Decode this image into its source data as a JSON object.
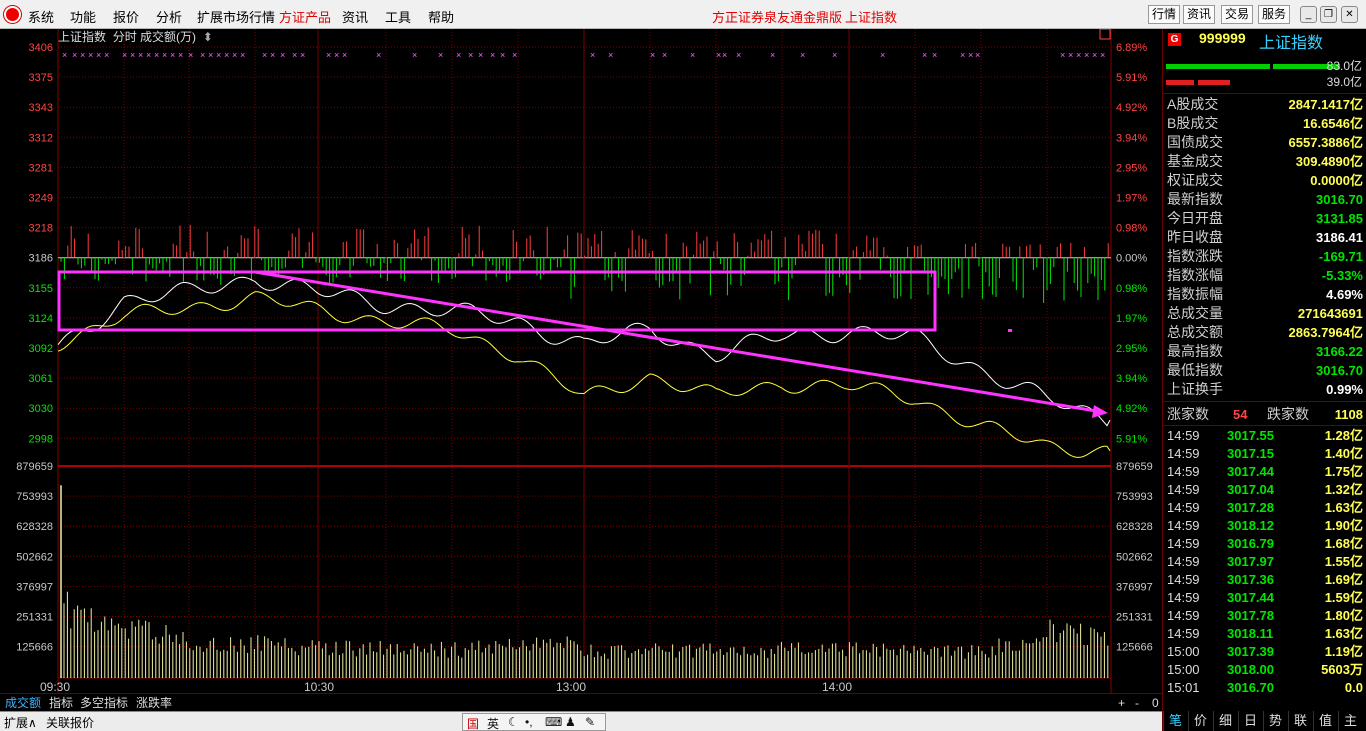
{
  "menubar": {
    "items": [
      "系统",
      "功能",
      "报价",
      "分析",
      "扩展市场行情",
      "方证产品",
      "资讯",
      "工具",
      "帮助"
    ],
    "center_label": "方正证券泉友通金鼎版",
    "center_index": "上证指数",
    "right_buttons": [
      "行情",
      "资讯",
      "交易",
      "服务"
    ]
  },
  "chart": {
    "index_name": "上证指数",
    "period": "分时",
    "indicator": "成交额(万)",
    "close_button": "×",
    "price_labels": [
      "3406",
      "3375",
      "3343",
      "3312",
      "3281",
      "3249",
      "3218",
      "3186",
      "3155",
      "3124",
      "3092",
      "3061",
      "3030",
      "2998"
    ],
    "percent_labels": [
      "6.89%",
      "5.91%",
      "4.92%",
      "3.94%",
      "2.95%",
      "1.97%",
      "0.98%",
      "0.00%",
      "0.98%",
      "1.97%",
      "2.95%",
      "3.94%",
      "4.92%",
      "5.91%"
    ],
    "volume_labels": [
      "879659",
      "753993",
      "628328",
      "502662",
      "376997",
      "251331",
      "125666"
    ],
    "time_labels": [
      "09:30",
      "10:30",
      "13:00",
      "14:00"
    ],
    "scroll_buttons": [
      "+",
      "-",
      "0"
    ]
  },
  "colors": {
    "up": "#ff3c3c",
    "down": "#00e600",
    "grid": "#7a0000",
    "price_line": "#ffffff",
    "avg_line": "#ffff3c",
    "annotation": "#ff33ff",
    "volume": "#f0f0a0"
  },
  "chart_data": {
    "type": "line",
    "title": "上证指数 分时",
    "x_axis": {
      "ticks": [
        "09:30",
        "10:30",
        "13:00",
        "14:00"
      ]
    },
    "y_range": [
      2998,
      3406
    ],
    "prev_close": 3186.41,
    "series": [
      {
        "name": "price",
        "x": [
          "09:30",
          "09:45",
          "10:00",
          "10:15",
          "10:30",
          "10:45",
          "11:00",
          "11:15",
          "11:30",
          "13:15",
          "13:30",
          "13:45",
          "14:00",
          "14:15",
          "14:30",
          "14:45",
          "15:00"
        ],
        "values": [
          3092,
          3142,
          3150,
          3166,
          3150,
          3138,
          3130,
          3120,
          3095,
          3112,
          3085,
          3105,
          3110,
          3102,
          3070,
          3038,
          3017
        ]
      },
      {
        "name": "average",
        "x": [
          "09:30",
          "09:45",
          "10:00",
          "10:15",
          "10:30",
          "10:45",
          "11:00",
          "11:15",
          "11:30",
          "13:15",
          "13:30",
          "13:45",
          "14:00",
          "14:15",
          "14:30",
          "14:45",
          "15:00"
        ],
        "values": [
          3098,
          3125,
          3135,
          3144,
          3132,
          3120,
          3110,
          3085,
          3040,
          3063,
          3042,
          3055,
          3052,
          3040,
          3010,
          2990,
          2985
        ]
      },
      {
        "name": "volume",
        "x": [
          "09:30",
          "09:35",
          "10:00",
          "10:30",
          "11:00",
          "11:30",
          "13:00",
          "13:30",
          "14:00",
          "14:30",
          "14:45",
          "15:00"
        ],
        "values": [
          800000,
          310000,
          200000,
          160000,
          150000,
          190000,
          140000,
          150000,
          150000,
          140000,
          250000,
          230000
        ]
      }
    ],
    "volume_range": [
      0,
      879659
    ]
  },
  "quote": {
    "code": "999999",
    "name": "上证指数",
    "badge": "G",
    "buy_bar_value": "83.0亿",
    "sell_bar_value": "39.0亿",
    "rows": [
      {
        "label": "A股成交",
        "value": "2847.1417亿",
        "color": "yel"
      },
      {
        "label": "B股成交",
        "value": "16.6546亿",
        "color": "yel"
      },
      {
        "label": "国债成交",
        "value": "6557.3886亿",
        "color": "yel"
      },
      {
        "label": "基金成交",
        "value": "309.4890亿",
        "color": "yel"
      },
      {
        "label": "权证成交",
        "value": "0.0000亿",
        "color": "yel"
      },
      {
        "label": "最新指数",
        "value": "3016.70",
        "color": "green"
      },
      {
        "label": "今日开盘",
        "value": "3131.85",
        "color": "green"
      },
      {
        "label": "昨日收盘",
        "value": "3186.41",
        "color": "white"
      },
      {
        "label": "指数涨跌",
        "value": "-169.71",
        "color": "green"
      },
      {
        "label": "指数涨幅",
        "value": "-5.33%",
        "color": "green"
      },
      {
        "label": "指数振幅",
        "value": "4.69%",
        "color": "white"
      },
      {
        "label": "总成交量",
        "value": "271643691",
        "color": "yel"
      },
      {
        "label": "总成交额",
        "value": "2863.7964亿",
        "color": "yel"
      },
      {
        "label": "最高指数",
        "value": "3166.22",
        "color": "green"
      },
      {
        "label": "最低指数",
        "value": "3016.70",
        "color": "green"
      },
      {
        "label": "上证换手",
        "value": "0.99%",
        "color": "white"
      }
    ],
    "up_label": "涨家数",
    "up_count": "54",
    "down_label": "跌家数",
    "down_count": "1108"
  },
  "ticks": [
    {
      "time": "14:59",
      "price": "3017.55",
      "amount": "1.28亿"
    },
    {
      "time": "14:59",
      "price": "3017.15",
      "amount": "1.40亿"
    },
    {
      "time": "14:59",
      "price": "3017.44",
      "amount": "1.75亿"
    },
    {
      "time": "14:59",
      "price": "3017.04",
      "amount": "1.32亿"
    },
    {
      "time": "14:59",
      "price": "3017.28",
      "amount": "1.63亿"
    },
    {
      "time": "14:59",
      "price": "3018.12",
      "amount": "1.90亿"
    },
    {
      "time": "14:59",
      "price": "3016.79",
      "amount": "1.68亿"
    },
    {
      "time": "14:59",
      "price": "3017.97",
      "amount": "1.55亿"
    },
    {
      "time": "14:59",
      "price": "3017.36",
      "amount": "1.69亿"
    },
    {
      "time": "14:59",
      "price": "3017.44",
      "amount": "1.59亿"
    },
    {
      "time": "14:59",
      "price": "3017.78",
      "amount": "1.80亿"
    },
    {
      "time": "14:59",
      "price": "3018.11",
      "amount": "1.63亿"
    },
    {
      "time": "15:00",
      "price": "3017.39",
      "amount": "1.19亿"
    },
    {
      "time": "15:00",
      "price": "3018.00",
      "amount": "5603万"
    },
    {
      "time": "15:01",
      "price": "3016.70",
      "amount": "0.0"
    }
  ],
  "bottom_tabs": [
    "成交额",
    "指标",
    "多空指标",
    "涨跌率"
  ],
  "bottom_bar": {
    "left1": "扩展∧",
    "left2": "关联报价"
  },
  "ime": {
    "mode1": "国",
    "mode2": "英"
  },
  "right_tabs": [
    "笔",
    "价",
    "细",
    "日",
    "势",
    "联",
    "值",
    "主"
  ]
}
